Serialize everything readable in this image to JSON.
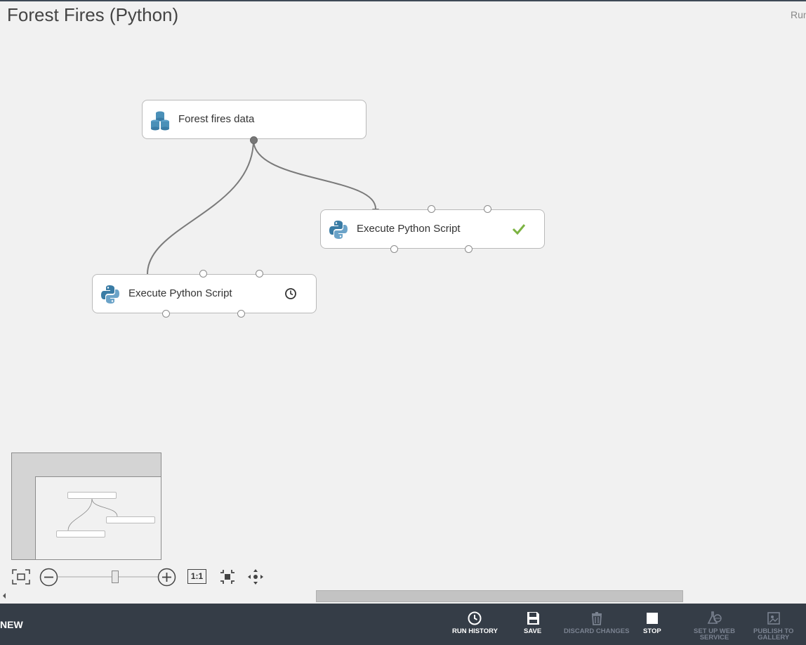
{
  "experiment": {
    "title": "Forest Fires (Python)",
    "run_label": "Run"
  },
  "nodes": {
    "data": {
      "label": "Forest fires data"
    },
    "script_right": {
      "label": "Execute Python Script",
      "status": "completed"
    },
    "script_left": {
      "label": "Execute Python Script",
      "status": "pending"
    }
  },
  "zoom": {
    "one_to_one_label": "1:1"
  },
  "toolbar": {
    "new_label": "NEW",
    "run_history_label": "RUN HISTORY",
    "save_label": "SAVE",
    "discard_label": "DISCARD CHANGES",
    "stop_label": "STOP",
    "web_service_line1": "SET UP WEB",
    "web_service_line2": "SERVICE",
    "publish_line1": "PUBLISH TO",
    "publish_line2": "GALLERY"
  },
  "colors": {
    "accent_check": "#7cb342",
    "bottom_bar": "#353d47",
    "canvas_bg": "#f1f1f1",
    "python_blue": "#3a7ca5"
  }
}
